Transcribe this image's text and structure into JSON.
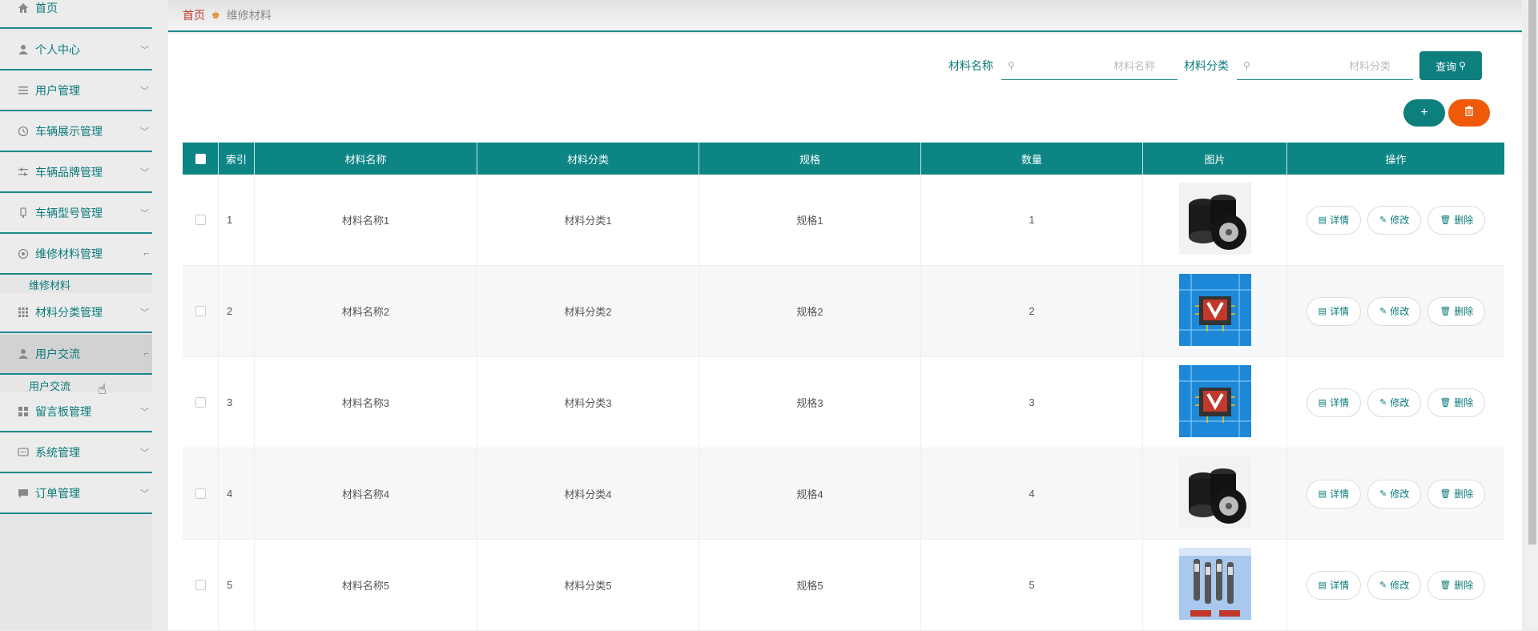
{
  "sidebar": {
    "items": [
      {
        "label": "首页",
        "icon": "home-icon"
      },
      {
        "label": "个人中心",
        "icon": "user-icon"
      },
      {
        "label": "用户管理",
        "icon": "list-icon"
      },
      {
        "label": "车辆展示管理",
        "icon": "clock-icon"
      },
      {
        "label": "车辆品牌管理",
        "icon": "sliders-icon"
      },
      {
        "label": "车辆型号管理",
        "icon": "tag-icon"
      },
      {
        "label": "维修材料管理",
        "icon": "gear-icon"
      },
      {
        "label": "材料分类管理",
        "icon": "grid-icon"
      },
      {
        "label": "用户交流",
        "icon": "user-icon"
      },
      {
        "label": "留言板管理",
        "icon": "apps-icon"
      },
      {
        "label": "系统管理",
        "icon": "chat-icon"
      },
      {
        "label": "订单管理",
        "icon": "message-icon"
      }
    ],
    "sub_items": {
      "repair": "维修材料",
      "exchange": "用户交流"
    }
  },
  "breadcrumb": {
    "home": "首页",
    "current": "维修材料"
  },
  "search": {
    "name_label": "材料名称",
    "name_placeholder": "材料名称",
    "category_label": "材料分类",
    "category_placeholder": "材料分类",
    "query_label": "查询"
  },
  "actions": {
    "add": "+",
    "delete": "🗑"
  },
  "table": {
    "headers": [
      "索引",
      "材料名称",
      "材料分类",
      "规格",
      "数量",
      "图片",
      "操作"
    ],
    "rows": [
      {
        "index": "1",
        "name": "材料名称1",
        "category": "材料分类1",
        "spec": "规格1",
        "qty": "1",
        "image": "tires"
      },
      {
        "index": "2",
        "name": "材料名称2",
        "category": "材料分类2",
        "spec": "规格2",
        "qty": "2",
        "image": "chip"
      },
      {
        "index": "3",
        "name": "材料名称3",
        "category": "材料分类3",
        "spec": "规格3",
        "qty": "3",
        "image": "chip"
      },
      {
        "index": "4",
        "name": "材料名称4",
        "category": "材料分类4",
        "spec": "规格4",
        "qty": "4",
        "image": "tires"
      },
      {
        "index": "5",
        "name": "材料名称5",
        "category": "材料分类5",
        "spec": "规格5",
        "qty": "5",
        "image": "plugs"
      }
    ],
    "ops": {
      "detail": "详情",
      "edit": "修改",
      "delete": "删除"
    }
  },
  "colors": {
    "accent": "#0d7f7f",
    "danger": "#ee5a0a",
    "breadcrumb_home": "#c0392b"
  }
}
